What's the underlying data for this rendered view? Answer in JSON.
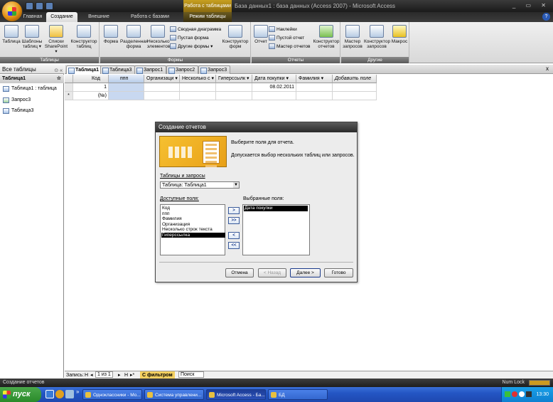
{
  "window": {
    "context_tab": "Работа с таблицами",
    "title": "База данных1 : база данных (Access 2007) - Microsoft Access",
    "controls": "_ ▭ ✕"
  },
  "ribbon_tabs": [
    "Главная",
    "Создание",
    "Внешние данные",
    "Работа с базами данных",
    "Режим таблицы"
  ],
  "ribbon": {
    "tables_group": {
      "label": "Таблицы",
      "buttons": [
        "Таблица",
        "Шаблоны таблиц ▾",
        "Списки SharePoint ▾",
        "Конструктор таблиц"
      ]
    },
    "forms_group": {
      "label": "Формы",
      "buttons": [
        "Форма",
        "Разделенная форма",
        "Несколько элементов",
        "Конструктор форм"
      ],
      "small": [
        "Сводная диаграмма",
        "Пустая форма",
        "Другие формы ▾"
      ]
    },
    "reports_group": {
      "label": "Отчеты",
      "buttons": [
        "Отчет",
        "Конструктор отчетов"
      ],
      "small": [
        "Наклейки",
        "Пустой отчет",
        "Мастер отчетов"
      ]
    },
    "other_group": {
      "label": "Другие",
      "buttons": [
        "Мастер запросов",
        "Конструктор запросов",
        "Макрос"
      ]
    }
  },
  "nav_pane": {
    "header": "Все таблицы",
    "header_controls": "⊙ «",
    "group": "Таблица1",
    "group_collapse": "☆",
    "items": [
      "Таблица1 : таблица",
      "Запрос3",
      "Таблица3"
    ]
  },
  "doc_tabs": [
    "Таблица1",
    "Таблица3",
    "Запрос1",
    "Запрос2",
    "Запрос3"
  ],
  "doc_close": "x",
  "datasheet": {
    "columns": [
      "Код",
      "ппп",
      "Организаци ▾",
      "Несколько с ▾",
      "Гиперссылк ▾",
      "Дата покупки ▾",
      "Фамилия ▾",
      "Добавить поле"
    ],
    "rows": [
      [
        "1",
        "",
        "",
        "",
        "",
        "08.02.2011",
        "",
        ""
      ],
      [
        "(№)",
        "",
        "",
        "",
        "",
        "",
        "",
        ""
      ]
    ],
    "new_row_marker": "*"
  },
  "record_nav": {
    "label": "Запись:",
    "first": "H",
    "prev": "◂",
    "position": "1 из 1",
    "next": "▸",
    "last": "H",
    "new": "▸*",
    "filter": "С фильтром",
    "search": "Поиск"
  },
  "status": {
    "text": "Создание отчетов",
    "numlock": "Num Lock"
  },
  "dialog": {
    "title": "Создание отчетов",
    "intro1": "Выберите поля для отчета.",
    "intro2": "Допускается выбор нескольких таблиц или запросов.",
    "tables_label": "Таблицы и запросы",
    "table_value": "Таблица: Таблица1",
    "available_label": "Доступные поля:",
    "selected_label": "Выбранные поля:",
    "available_fields": [
      "Код",
      "ппп",
      "Фамилия",
      "Организация",
      "Несколько строк текста",
      "Гиперссылка"
    ],
    "selected_index": 5,
    "selected_fields": [
      "Дата покупки"
    ],
    "move_buttons": [
      ">",
      ">>",
      "<",
      "<<"
    ],
    "buttons": {
      "cancel": "Отмена",
      "back": "< Назад",
      "next": "Далее >",
      "finish": "Готово"
    }
  },
  "taskbar": {
    "start": "пуск",
    "overflow": "»",
    "buttons": [
      "Одноклассники - Мо...",
      "Система управлени...",
      "Microsoft Access - Ба...",
      "БД"
    ],
    "clock": "13:30"
  }
}
